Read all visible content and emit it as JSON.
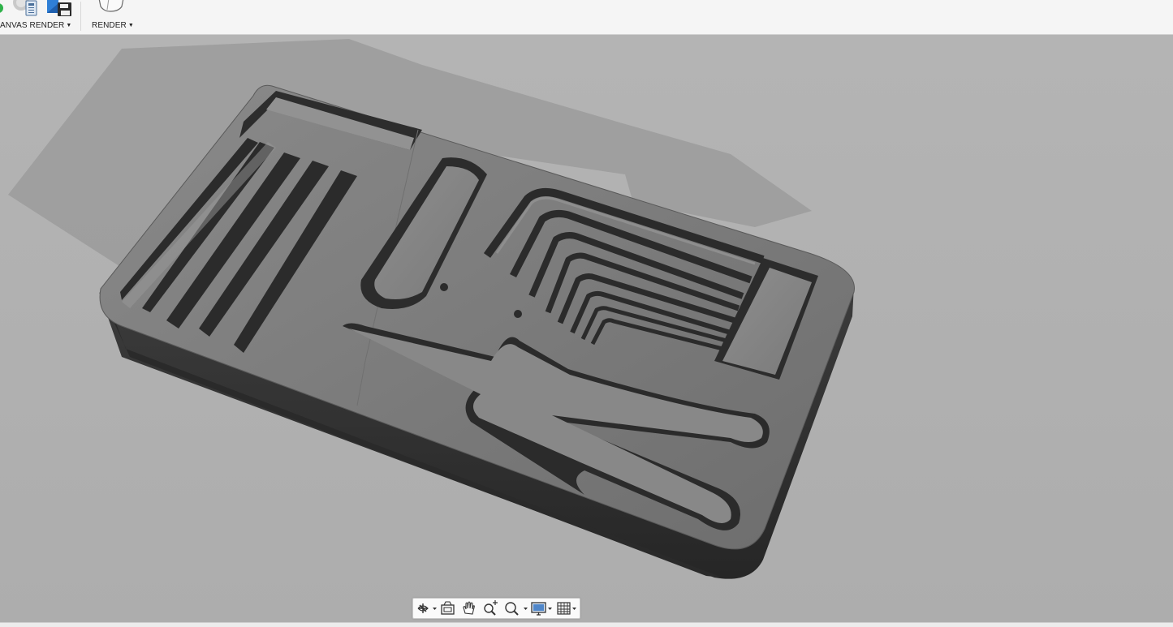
{
  "toolbar": {
    "groups": [
      {
        "label": "ANVAS RENDER",
        "has_dropdown": true
      },
      {
        "label": "RENDER",
        "has_dropdown": true
      }
    ]
  },
  "viewport": {
    "subject": "foam tool organizer tray",
    "background_color": "#b3b3b3",
    "tray_color": "#6e6e6e"
  },
  "navbar": {
    "tools": [
      {
        "name": "orbit-icon",
        "has_dropdown": true
      },
      {
        "name": "look-at-icon",
        "has_dropdown": false
      },
      {
        "name": "pan-icon",
        "has_dropdown": false
      },
      {
        "name": "zoom-icon",
        "has_dropdown": false
      },
      {
        "name": "fit-icon",
        "has_dropdown": true
      },
      {
        "name": "display-settings-icon",
        "has_dropdown": true
      },
      {
        "name": "grid-settings-icon",
        "has_dropdown": true
      }
    ]
  }
}
